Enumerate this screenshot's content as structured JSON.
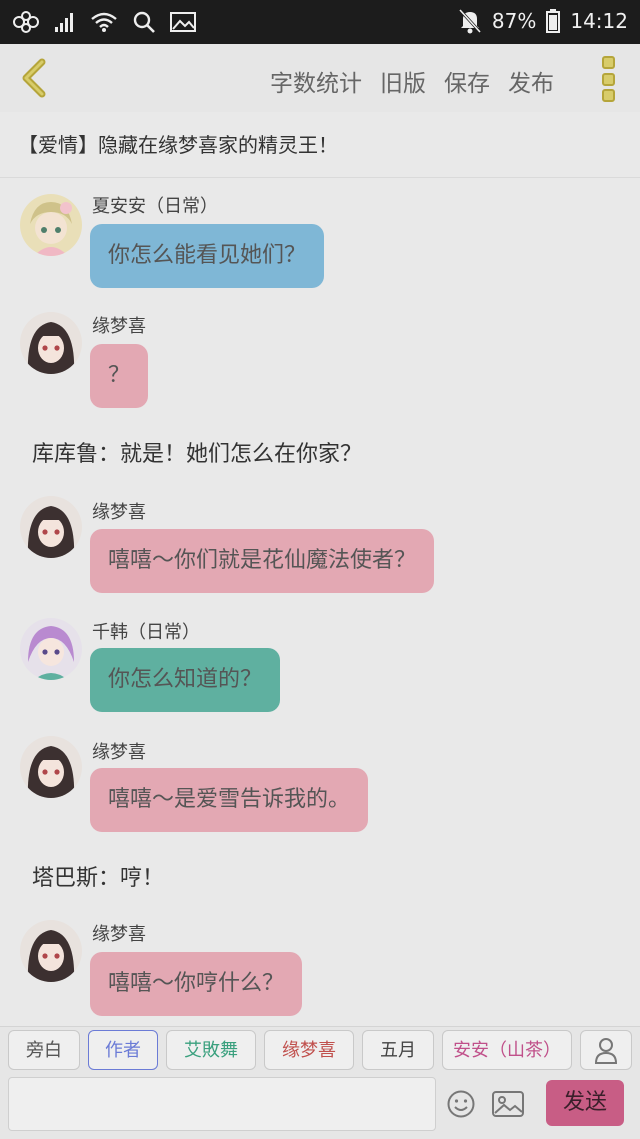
{
  "status_bar": {
    "battery": "87%",
    "time": "14:12"
  },
  "toolbar": {
    "word_count": "字数统计",
    "old_version": "旧版",
    "save": "保存",
    "publish": "发布"
  },
  "story": {
    "title": "【爱情】隐藏在缘梦喜家的精灵王！"
  },
  "messages": [
    {
      "speaker": "夏安安（日常）",
      "text": "你怎么能看见她们？",
      "bubble_color": "#7fb7d6",
      "avatar": "character-xiaanan"
    },
    {
      "speaker": "缘梦喜",
      "text": "？",
      "bubble_color": "#e3a8b3",
      "avatar": "character-yuanmengxi"
    },
    {
      "narration": "库库鲁：就是！她们怎么在你家？"
    },
    {
      "speaker": "缘梦喜",
      "text": "嘻嘻～你们就是花仙魔法使者？",
      "bubble_color": "#e3a8b3",
      "avatar": "character-yuanmengxi"
    },
    {
      "speaker": "千韩（日常）",
      "text": "你怎么知道的？",
      "bubble_color": "#5fb0a0",
      "avatar": "character-qianhan"
    },
    {
      "speaker": "缘梦喜",
      "text": "嘻嘻～是爱雪告诉我的。",
      "bubble_color": "#e3a8b3",
      "avatar": "character-yuanmengxi"
    },
    {
      "narration": "塔巴斯：哼！"
    },
    {
      "speaker": "缘梦喜",
      "text": "嘻嘻～你哼什么？",
      "bubble_color": "#e3a8b3",
      "avatar": "character-yuanmengxi"
    }
  ],
  "role_chips": [
    {
      "label": "旁白",
      "color": "#555555"
    },
    {
      "label": "作者",
      "color": "#6b7bd6"
    },
    {
      "label": "艾敗舞",
      "color": "#3aa07e"
    },
    {
      "label": "缘梦喜",
      "color": "#c0504d"
    },
    {
      "label": "五月",
      "color": "#444444"
    },
    {
      "label": "安安（山茶）",
      "color": "#c0508a"
    }
  ],
  "composer": {
    "input_value": "",
    "send": "发送"
  },
  "colors": {
    "accent_pink": "#c85d85",
    "active_chip": "#6b7bd6"
  }
}
